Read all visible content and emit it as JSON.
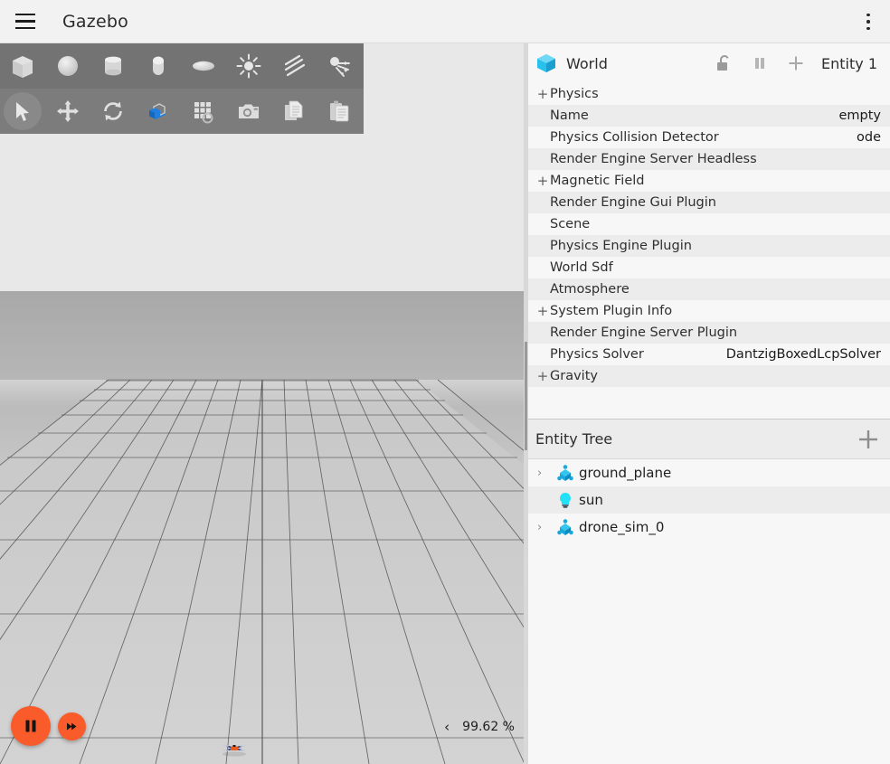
{
  "titlebar": {
    "app_title": "Gazebo",
    "menu_icon": "hamburger-menu-icon",
    "overflow_icon": "kebab-menu-icon"
  },
  "toolbar_shapes": [
    {
      "name": "box",
      "icon": "box-shape-icon"
    },
    {
      "name": "sphere",
      "icon": "sphere-shape-icon"
    },
    {
      "name": "cylinder",
      "icon": "cylinder-shape-icon"
    },
    {
      "name": "capsule",
      "icon": "capsule-shape-icon"
    },
    {
      "name": "ellipsoid",
      "icon": "ellipsoid-shape-icon"
    },
    {
      "name": "point light",
      "icon": "point-light-icon"
    },
    {
      "name": "directional light",
      "icon": "directional-light-icon"
    },
    {
      "name": "spot light",
      "icon": "spot-light-icon"
    }
  ],
  "toolbar_tools": [
    {
      "name": "select mode",
      "icon": "cursor-arrow-icon",
      "active": true
    },
    {
      "name": "translate mode",
      "icon": "move-arrows-icon",
      "active": false
    },
    {
      "name": "rotate mode",
      "icon": "rotate-arrows-icon",
      "active": false
    },
    {
      "name": "scale mode",
      "icon": "scale-cube-icon",
      "active": false
    },
    {
      "name": "snap to grid",
      "icon": "grid-snap-icon",
      "active": false
    },
    {
      "name": "screenshot",
      "icon": "camera-icon",
      "active": false
    },
    {
      "name": "copy",
      "icon": "copy-icon",
      "active": false
    },
    {
      "name": "paste",
      "icon": "paste-icon",
      "active": false
    }
  ],
  "viewport": {
    "play_button_icon": "pause-icon",
    "step_button_icon": "step-forward-icon",
    "rtf_collapse_icon": "chevron-left-icon",
    "real_time_factor": "99.62 %"
  },
  "world_panel": {
    "title": "World",
    "cube_icon": "blue-cube-icon",
    "lock_icon": "unlocked-padlock-icon",
    "pause_icon": "pause-bars-icon",
    "add_icon": "plus-icon",
    "entity_label": "Entity 1",
    "properties": [
      {
        "expander": "+",
        "name": "Physics",
        "value": ""
      },
      {
        "expander": "",
        "name": "Name",
        "value": "empty"
      },
      {
        "expander": "",
        "name": "Physics Collision Detector",
        "value": "ode"
      },
      {
        "expander": "",
        "name": "Render Engine Server Headless",
        "value": ""
      },
      {
        "expander": "+",
        "name": "Magnetic Field",
        "value": ""
      },
      {
        "expander": "",
        "name": "Render Engine Gui Plugin",
        "value": ""
      },
      {
        "expander": "",
        "name": "Scene",
        "value": ""
      },
      {
        "expander": "",
        "name": "Physics Engine Plugin",
        "value": ""
      },
      {
        "expander": "",
        "name": "World Sdf",
        "value": ""
      },
      {
        "expander": "",
        "name": "Atmosphere",
        "value": ""
      },
      {
        "expander": "+",
        "name": "System Plugin Info",
        "value": ""
      },
      {
        "expander": "",
        "name": "Render Engine Server Plugin",
        "value": ""
      },
      {
        "expander": "",
        "name": "Physics Solver",
        "value": "DantzigBoxedLcpSolver"
      },
      {
        "expander": "+",
        "name": "Gravity",
        "value": ""
      }
    ]
  },
  "entity_tree": {
    "title": "Entity Tree",
    "add_icon": "plus-icon",
    "items": [
      {
        "label": "ground_plane",
        "icon": "model-node-icon",
        "expandable": true,
        "arrow": "›"
      },
      {
        "label": "sun",
        "icon": "light-bulb-icon",
        "expandable": false,
        "arrow": "›"
      },
      {
        "label": "drone_sim_0",
        "icon": "model-node-icon",
        "expandable": true,
        "arrow": "›"
      }
    ]
  },
  "colors": {
    "accent_orange": "#f95b2a",
    "entity_cyan": "#22bfe8",
    "toolbar_dark": "#737373",
    "toolbar_light": "#7c7c7c",
    "panel_bg": "#f7f7f7",
    "row_alt": "#ececec"
  }
}
